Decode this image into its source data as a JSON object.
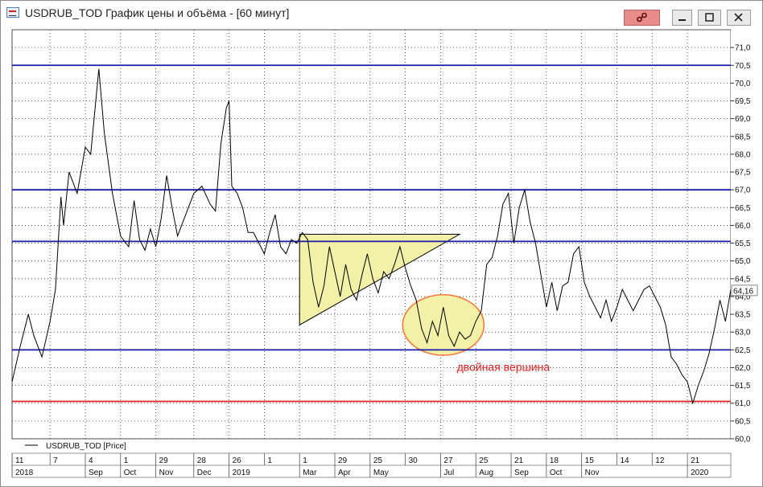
{
  "window": {
    "title": "USDRUB_TOD График цены и объёма - [60 минут]",
    "buttons": {
      "link_icon": "link-icon",
      "minimize_icon": "minimize-icon",
      "maximize_icon": "maximize-icon",
      "close_icon": "close-icon"
    }
  },
  "chart_data": {
    "type": "line",
    "title": "",
    "series": [
      {
        "name": "USDRUB_TOD [Price]",
        "color": "#000000",
        "points": [
          [
            0,
            61.6
          ],
          [
            3,
            62.6
          ],
          [
            6,
            63.5
          ],
          [
            8,
            62.9
          ],
          [
            11,
            62.3
          ],
          [
            14,
            63.3
          ],
          [
            16,
            64.2
          ],
          [
            18,
            66.8
          ],
          [
            19,
            66.0
          ],
          [
            21,
            67.5
          ],
          [
            24,
            66.9
          ],
          [
            27,
            68.2
          ],
          [
            29,
            68.0
          ],
          [
            32,
            70.4
          ],
          [
            34,
            68.6
          ],
          [
            37,
            66.9
          ],
          [
            40,
            65.7
          ],
          [
            43,
            65.4
          ],
          [
            45,
            66.7
          ],
          [
            47,
            65.6
          ],
          [
            49,
            65.3
          ],
          [
            51,
            65.9
          ],
          [
            53,
            65.4
          ],
          [
            55,
            66.2
          ],
          [
            57,
            67.4
          ],
          [
            59,
            66.5
          ],
          [
            61,
            65.7
          ],
          [
            64,
            66.3
          ],
          [
            67,
            66.9
          ],
          [
            70,
            67.1
          ],
          [
            73,
            66.6
          ],
          [
            75,
            66.4
          ],
          [
            77,
            68.3
          ],
          [
            79,
            69.3
          ],
          [
            80,
            69.5
          ],
          [
            81,
            67.1
          ],
          [
            83,
            66.9
          ],
          [
            85,
            66.5
          ],
          [
            87,
            65.8
          ],
          [
            89,
            65.8
          ],
          [
            91,
            65.5
          ],
          [
            93,
            65.2
          ],
          [
            95,
            65.8
          ],
          [
            97,
            66.3
          ],
          [
            99,
            65.4
          ],
          [
            101,
            65.2
          ],
          [
            103,
            65.6
          ],
          [
            105,
            65.5
          ],
          [
            107,
            65.8
          ],
          [
            109,
            65.6
          ],
          [
            111,
            64.4
          ],
          [
            113,
            63.7
          ],
          [
            115,
            64.3
          ],
          [
            117,
            65.4
          ],
          [
            119,
            64.7
          ],
          [
            121,
            64.0
          ],
          [
            123,
            64.9
          ],
          [
            125,
            64.2
          ],
          [
            127,
            63.9
          ],
          [
            129,
            64.6
          ],
          [
            131,
            65.2
          ],
          [
            133,
            64.5
          ],
          [
            135,
            64.1
          ],
          [
            137,
            64.7
          ],
          [
            139,
            64.5
          ],
          [
            141,
            64.9
          ],
          [
            143,
            65.4
          ],
          [
            145,
            64.8
          ],
          [
            147,
            64.3
          ],
          [
            149,
            63.9
          ],
          [
            151,
            63.1
          ],
          [
            153,
            62.7
          ],
          [
            155,
            63.3
          ],
          [
            157,
            62.9
          ],
          [
            159,
            63.7
          ],
          [
            161,
            62.9
          ],
          [
            163,
            62.6
          ],
          [
            165,
            63.0
          ],
          [
            167,
            62.8
          ],
          [
            169,
            62.9
          ],
          [
            171,
            63.3
          ],
          [
            173,
            63.6
          ],
          [
            175,
            64.9
          ],
          [
            177,
            65.1
          ],
          [
            179,
            65.7
          ],
          [
            181,
            66.6
          ],
          [
            183,
            66.9
          ],
          [
            185,
            65.5
          ],
          [
            187,
            66.5
          ],
          [
            189,
            67.0
          ],
          [
            191,
            66.1
          ],
          [
            193,
            65.5
          ],
          [
            195,
            64.6
          ],
          [
            197,
            63.7
          ],
          [
            199,
            64.4
          ],
          [
            201,
            63.6
          ],
          [
            203,
            64.3
          ],
          [
            205,
            64.4
          ],
          [
            207,
            65.2
          ],
          [
            209,
            65.4
          ],
          [
            211,
            64.4
          ],
          [
            213,
            64.0
          ],
          [
            215,
            63.7
          ],
          [
            217,
            63.4
          ],
          [
            219,
            63.9
          ],
          [
            221,
            63.3
          ],
          [
            223,
            63.7
          ],
          [
            225,
            64.2
          ],
          [
            227,
            63.9
          ],
          [
            229,
            63.6
          ],
          [
            231,
            63.9
          ],
          [
            233,
            64.2
          ],
          [
            235,
            64.3
          ],
          [
            237,
            64.0
          ],
          [
            239,
            63.7
          ],
          [
            241,
            63.2
          ],
          [
            243,
            62.3
          ],
          [
            245,
            62.1
          ],
          [
            247,
            61.8
          ],
          [
            249,
            61.6
          ],
          [
            251,
            61.0
          ],
          [
            253,
            61.5
          ],
          [
            255,
            61.9
          ],
          [
            257,
            62.4
          ],
          [
            259,
            63.1
          ],
          [
            261,
            63.9
          ],
          [
            263,
            63.3
          ],
          [
            265,
            64.2
          ]
        ]
      }
    ],
    "y_axis": {
      "min": 60.0,
      "max": 71.5,
      "ticks": [
        "60,0",
        "60,5",
        "61,0",
        "61,5",
        "62,0",
        "62,5",
        "63,0",
        "63,5",
        "64,0",
        "64,5",
        "65,0",
        "65,5",
        "66,0",
        "66,5",
        "67,0",
        "67,5",
        "68,0",
        "68,5",
        "69,0",
        "69,5",
        "70,0",
        "70,5",
        "71,0"
      ]
    },
    "last_value_label": "64,16",
    "x_axis": {
      "x_range": [
        0,
        265
      ],
      "top_row": [
        {
          "x": 0,
          "label": "11"
        },
        {
          "x": 14,
          "label": "7"
        },
        {
          "x": 27,
          "label": "4"
        },
        {
          "x": 40,
          "label": "1"
        },
        {
          "x": 53,
          "label": "29"
        },
        {
          "x": 67,
          "label": "28"
        },
        {
          "x": 80,
          "label": "26"
        },
        {
          "x": 93,
          "label": "1"
        },
        {
          "x": 106,
          "label": "1"
        },
        {
          "x": 119,
          "label": "29"
        },
        {
          "x": 132,
          "label": "25"
        },
        {
          "x": 145,
          "label": "30"
        },
        {
          "x": 158,
          "label": "27"
        },
        {
          "x": 171,
          "label": "25"
        },
        {
          "x": 184,
          "label": "21"
        },
        {
          "x": 197,
          "label": "18"
        },
        {
          "x": 210,
          "label": "15"
        },
        {
          "x": 223,
          "label": "14"
        },
        {
          "x": 236,
          "label": "12"
        },
        {
          "x": 249,
          "label": "21"
        }
      ],
      "bottom_row": [
        {
          "x": 0,
          "label": "2018"
        },
        {
          "x": 27,
          "label": "Sep"
        },
        {
          "x": 40,
          "label": "Oct"
        },
        {
          "x": 53,
          "label": "Nov"
        },
        {
          "x": 67,
          "label": "Dec"
        },
        {
          "x": 80,
          "label": "2019"
        },
        {
          "x": 106,
          "label": "Mar"
        },
        {
          "x": 119,
          "label": "Apr"
        },
        {
          "x": 132,
          "label": "May"
        },
        {
          "x": 158,
          "label": "Jul"
        },
        {
          "x": 171,
          "label": "Aug"
        },
        {
          "x": 184,
          "label": "Sep"
        },
        {
          "x": 197,
          "label": "Oct"
        },
        {
          "x": 210,
          "label": "Nov"
        },
        {
          "x": 249,
          "label": "2020"
        }
      ]
    },
    "horizontal_levels": [
      {
        "y": 70.5,
        "color": "#1a1aa8"
      },
      {
        "y": 67.0,
        "color": "#1a1aa8"
      },
      {
        "y": 65.55,
        "color": "#1a1aa8"
      },
      {
        "y": 62.5,
        "color": "#1a1aa8"
      },
      {
        "y": 61.05,
        "color": "#e02020"
      }
    ],
    "annotations": {
      "triangle": {
        "points": [
          [
            106,
            65.75
          ],
          [
            106,
            63.2
          ],
          [
            165,
            65.75
          ]
        ],
        "fill": "#f3f0a8"
      },
      "ellipse": {
        "cx": 159,
        "cy": 63.2,
        "rx": 15,
        "ry": 0.85,
        "fill": "#f3f0a8",
        "stroke": "#f07a3c"
      },
      "label": {
        "text": "двойная вершина",
        "x": 164,
        "y": 62.0,
        "color": "#e02020"
      }
    },
    "legend": {
      "label": "USDRUB_TOD [Price]",
      "position": "bottom-left"
    },
    "grid": true
  }
}
